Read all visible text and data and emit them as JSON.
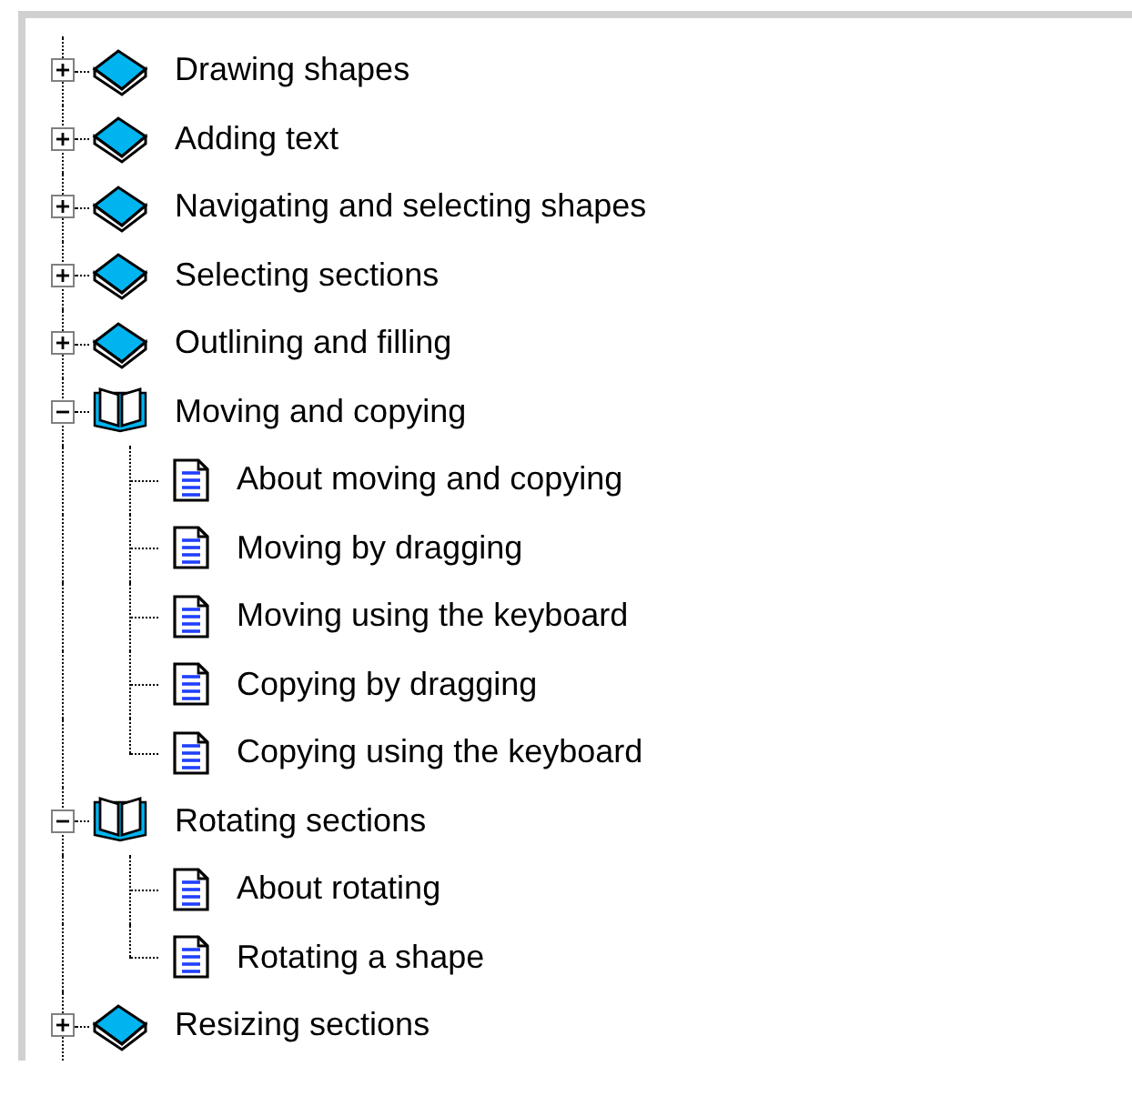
{
  "tree": [
    {
      "label": "Drawing shapes",
      "expanded": false
    },
    {
      "label": "Adding text",
      "expanded": false
    },
    {
      "label": "Navigating and selecting shapes",
      "expanded": false
    },
    {
      "label": "Selecting sections",
      "expanded": false
    },
    {
      "label": "Outlining and filling",
      "expanded": false
    },
    {
      "label": "Moving and copying",
      "expanded": true,
      "children": [
        {
          "label": "About moving and copying"
        },
        {
          "label": "Moving by dragging"
        },
        {
          "label": "Moving using the keyboard"
        },
        {
          "label": "Copying by dragging"
        },
        {
          "label": "Copying using the keyboard"
        }
      ]
    },
    {
      "label": "Rotating sections",
      "expanded": true,
      "children": [
        {
          "label": "About rotating"
        },
        {
          "label": "Rotating a shape"
        }
      ]
    },
    {
      "label": "Resizing sections",
      "expanded": false
    }
  ]
}
